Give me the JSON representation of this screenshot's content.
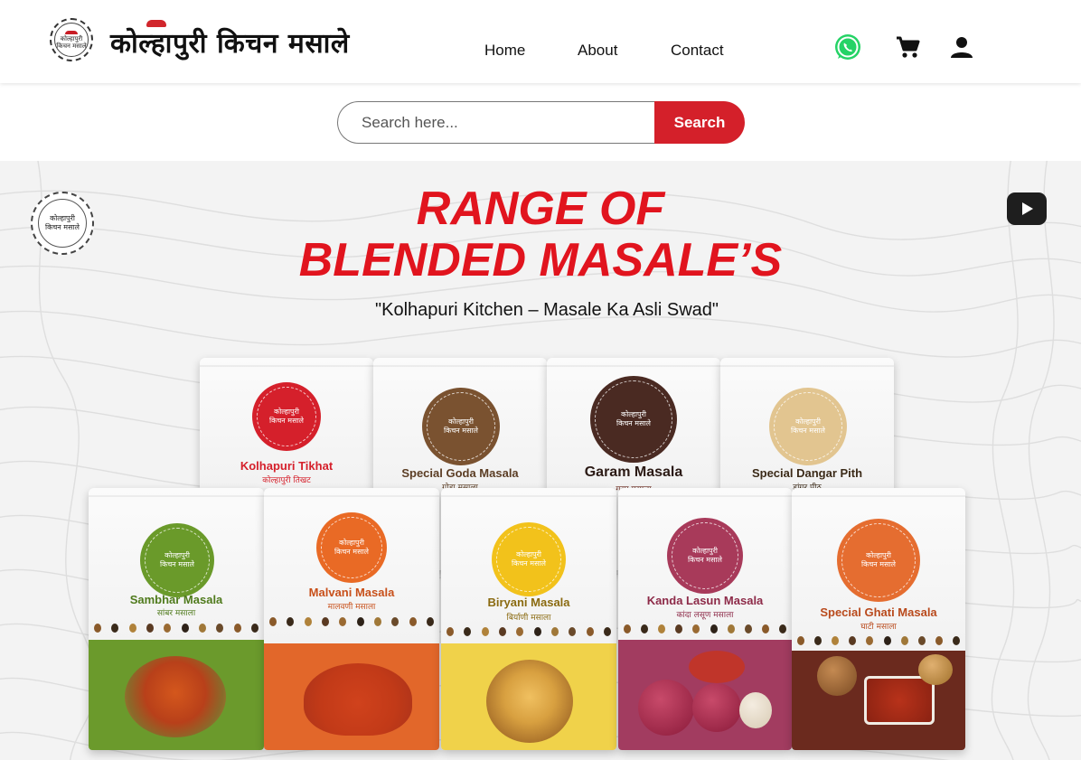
{
  "brand": {
    "seal_line1": "कोल्हापुरी",
    "seal_line2": "किचन मसाले",
    "wordmark": "कोल्हापुरी किचन मसाले"
  },
  "nav": {
    "home": "Home",
    "about": "About",
    "contact": "Contact"
  },
  "header_icons": [
    "whatsapp-icon",
    "cart-icon",
    "user-icon"
  ],
  "search": {
    "placeholder": "Search here...",
    "button": "Search"
  },
  "hero": {
    "title_line1": "RANGE OF",
    "title_line2": "BLENDED MASALE’S",
    "tagline": "\"Kolhapuri Kitchen – Masale Ka Asli Swad\"",
    "youtube_icon": "youtube-icon"
  },
  "products_back": [
    {
      "name": "Kolhapuri Tikhat",
      "sub": "कोल्हापुरी तिखट",
      "color": "#d5202b",
      "name_color": "#d5202b"
    },
    {
      "name": "Special Goda Masala",
      "sub": "गोडा मसाला",
      "color": "#7a5230",
      "name_color": "#5b3d24"
    },
    {
      "name": "Garam Masala",
      "sub": "गरम मसाला",
      "color": "#4a2a22",
      "name_color": "#2b1a15"
    },
    {
      "name": "Special Dangar Pith",
      "sub": "डांगर पीठ",
      "color": "#e2c590",
      "name_color": "#3b2a18"
    }
  ],
  "products_front": [
    {
      "name": "Sambhar Masala",
      "sub": "सांबर मसाला",
      "color": "#6a9a2a",
      "name_color": "#4f7a1c",
      "panel": "#6b9a2c"
    },
    {
      "name": "Malvani Masala",
      "sub": "मालवणी मसाला",
      "color": "#e96a25",
      "name_color": "#c8501a",
      "panel": "#e2672a"
    },
    {
      "name": "Biryani Masala",
      "sub": "बिर्याणी मसाला",
      "color": "#f2c21b",
      "name_color": "#8a6a10",
      "panel": "#f0d24a"
    },
    {
      "name": "Kanda Lasun Masala",
      "sub": "कांदा लसूण मसाला",
      "color": "#a83a5a",
      "name_color": "#8d2a48",
      "panel": "#a23c60"
    },
    {
      "name": "Special Ghati Masala",
      "sub": "घाटी मसाला",
      "color": "#e56d30",
      "name_color": "#b94a1c",
      "panel": "#6b2a1e"
    }
  ],
  "colors": {
    "accent": "#e1141e",
    "search_button": "#d4202a",
    "whatsapp": "#25d366"
  }
}
